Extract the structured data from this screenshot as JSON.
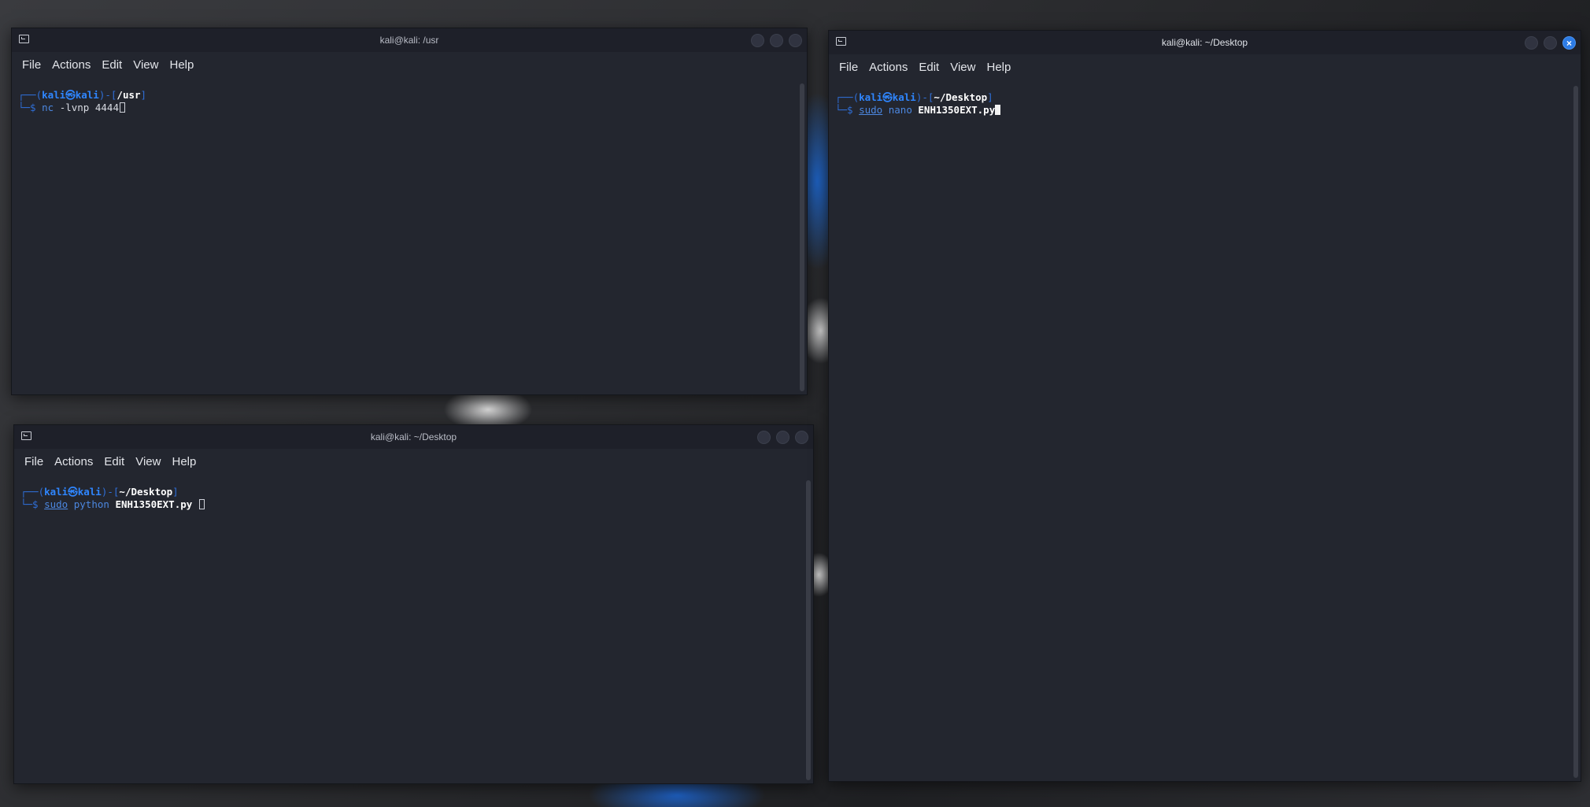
{
  "windows": [
    {
      "title": "kali@kali: /usr",
      "menu": [
        "File",
        "Actions",
        "Edit",
        "View",
        "Help"
      ],
      "prompt": {
        "user": "kali",
        "at": "㉿",
        "host": "kali",
        "path": "/usr"
      },
      "command": {
        "program": "nc",
        "args": "-lvnp",
        "value": "4444"
      }
    },
    {
      "title": "kali@kali: ~/Desktop",
      "menu": [
        "File",
        "Actions",
        "Edit",
        "View",
        "Help"
      ],
      "prompt": {
        "user": "kali",
        "at": "㉿",
        "host": "kali",
        "path": "~/Desktop"
      },
      "command": {
        "sudo": "sudo",
        "program": "python",
        "value": "ENH1350EXT.py"
      }
    },
    {
      "title": "kali@kali: ~/Desktop",
      "menu": [
        "File",
        "Actions",
        "Edit",
        "View",
        "Help"
      ],
      "prompt": {
        "user": "kali",
        "at": "㉿",
        "host": "kali",
        "path": "~/Desktop"
      },
      "command": {
        "sudo": "sudo",
        "program": "nano",
        "value": "ENH1350EXT.py"
      }
    }
  ],
  "close_glyph": "×",
  "colors": {
    "terminal_bg": "#23262f",
    "titlebar_bg": "#1e2029",
    "prompt_blue": "#2f86ff",
    "accent_close": "#2c7be5"
  }
}
